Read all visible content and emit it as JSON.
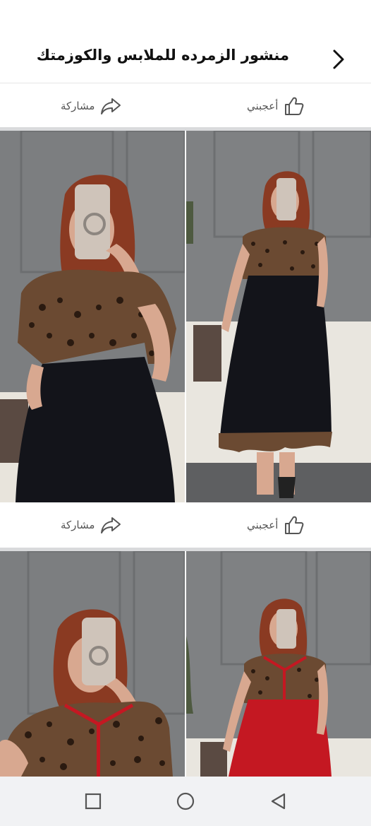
{
  "header": {
    "title": "منشور الزمرده للملابس والكوزمتك",
    "back_icon": "chevron-right-icon"
  },
  "post_actions": [
    {
      "like_label": "أعجبني",
      "share_label": "مشاركة"
    },
    {
      "like_label": "أعجبني",
      "share_label": "مشاركة"
    }
  ],
  "photos": [
    {
      "subject": "leopard-black-dress-closeup"
    },
    {
      "subject": "leopard-black-dress-full"
    },
    {
      "subject": "leopard-red-dress-closeup"
    },
    {
      "subject": "leopard-red-dress-full"
    }
  ],
  "system_nav": {
    "icons": [
      "recents-square-icon",
      "home-circle-icon",
      "back-triangle-icon"
    ]
  },
  "colors": {
    "background": "#ffffff",
    "divider": "#d9dadc",
    "wall": "#7c7e80",
    "leopard": "#6b4a32",
    "black_dress": "#13141a",
    "red_dress": "#c41822",
    "hair": "#8a3a22",
    "nav_bar": "#f1f2f4"
  }
}
